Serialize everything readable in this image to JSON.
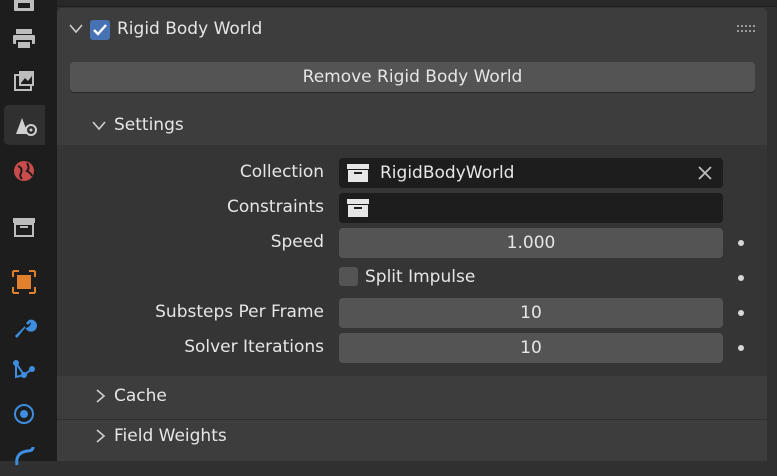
{
  "tabs": [
    {
      "icon": "render-icon"
    },
    {
      "icon": "output-icon"
    },
    {
      "icon": "view-layer-icon"
    },
    {
      "icon": "scene-icon",
      "active": true
    },
    {
      "icon": "world-icon"
    },
    {
      "icon": "collection-icon"
    },
    {
      "icon": "object-icon"
    },
    {
      "icon": "modifier-wrench-icon"
    },
    {
      "icon": "particles-icon"
    },
    {
      "icon": "physics-icon"
    },
    {
      "icon": "constraints-icon"
    }
  ],
  "panel": {
    "title": "Rigid Body World",
    "enabled": true,
    "remove_button": "Remove Rigid Body World",
    "accent": "#4772b3"
  },
  "settings": {
    "title": "Settings",
    "collection": {
      "label": "Collection",
      "value": "RigidBodyWorld"
    },
    "constraints": {
      "label": "Constraints",
      "value": ""
    },
    "speed": {
      "label": "Speed",
      "value": "1.000"
    },
    "split_impulse": {
      "label": "Split Impulse",
      "checked": false
    },
    "substeps": {
      "label": "Substeps Per Frame",
      "value": "10"
    },
    "solver_iterations": {
      "label": "Solver Iterations",
      "value": "10"
    }
  },
  "subpanels": {
    "cache": "Cache",
    "field_weights": "Field Weights"
  }
}
